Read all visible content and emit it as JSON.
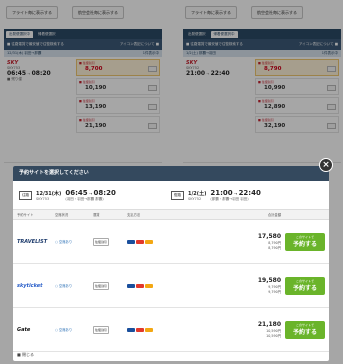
{
  "top_buttons": [
    {
      "label": "フライト毎に表示する"
    },
    {
      "label": "航空会社毎に表示する"
    },
    {
      "label": "フライト毎に表示する"
    },
    {
      "label": "航空会社毎に表示する"
    }
  ],
  "columns": [
    {
      "tabs": [
        "出発便選択中",
        "帰着便選択"
      ],
      "bar_left": "■ 往路運賃で最安値で往復検索する",
      "bar_right": "アイコン表記について ■",
      "sub_left": "12/31(木) 羽田→那覇",
      "sub_right": "1件表示中",
      "airline": "SKY",
      "flight": "SKY753",
      "dep": "06:45",
      "arr": "08:20",
      "seat": "■ 残り僅",
      "fares": [
        {
          "label": "■ 往復割引",
          "price": "8,700",
          "highlight": true
        },
        {
          "label": "■ 往復割引",
          "price": "10,190",
          "highlight": false
        },
        {
          "label": "■ 往復割引",
          "price": "13,190",
          "highlight": false
        },
        {
          "label": "■ 往復割引",
          "price": "21,190",
          "highlight": false
        }
      ]
    },
    {
      "tabs": [
        "出発便選択",
        "帰着便選択中"
      ],
      "bar_left": "■ 往路運賃で最安値で往復検索する",
      "bar_right": "アイコン表記について ■",
      "sub_left": "1/2(土) 那覇→羽田",
      "sub_right": "1件表示中",
      "airline": "SKY",
      "flight": "SKY752",
      "dep": "21:00",
      "arr": "22:40",
      "seat": "",
      "fares": [
        {
          "label": "■ 往復割引",
          "price": "8,790",
          "highlight": true
        },
        {
          "label": "■ 往復割引",
          "price": "10,990",
          "highlight": false
        },
        {
          "label": "■ 往復割引",
          "price": "12,890",
          "highlight": false
        },
        {
          "label": "■ 往復割引",
          "price": "32,190",
          "highlight": false
        }
      ]
    }
  ],
  "modal": {
    "title": "予約サイトを選択してください",
    "outbound": {
      "tag": "往路",
      "date": "12/31(木)",
      "flight": "SKY753",
      "dep": "06:45",
      "arr": "08:20",
      "route": "(羽田・羽田→那覇 那覇)"
    },
    "return": {
      "tag": "復路",
      "date": "1/2(土)",
      "flight": "SKY752",
      "dep": "21:00",
      "arr": "22:40",
      "route": "(那覇・那覇→羽田 羽田)"
    },
    "headers": [
      "予約サイト",
      "空席状況",
      "運賃",
      "支払方法",
      "合計金額"
    ],
    "rows": [
      {
        "site": "TRAVELIST",
        "seat": "○ 空席あり",
        "class": "往復割引",
        "total": "17,580",
        "fees": [
          "8,790円",
          "8,790円"
        ],
        "btn_small": "このサイトで",
        "btn": "予約する"
      },
      {
        "site": "skyticket",
        "seat": "○ 空席あり",
        "class": "往復割引",
        "total": "19,580",
        "fees": [
          "9,790円",
          "9,790円"
        ],
        "btn_small": "このサイトで",
        "btn": "予約する"
      },
      {
        "site": "Gate",
        "seat": "○ 空席あり",
        "class": "往復割引",
        "total": "21,180",
        "fees": [
          "10,590円",
          "10,590円"
        ],
        "btn_small": "このサイトで",
        "btn": "予約する"
      }
    ],
    "footer": "■ 閉じる"
  },
  "close_label": "×",
  "colors": {
    "navy": "#2c4a66",
    "green": "#6ab42a",
    "red": "#d0021b"
  }
}
